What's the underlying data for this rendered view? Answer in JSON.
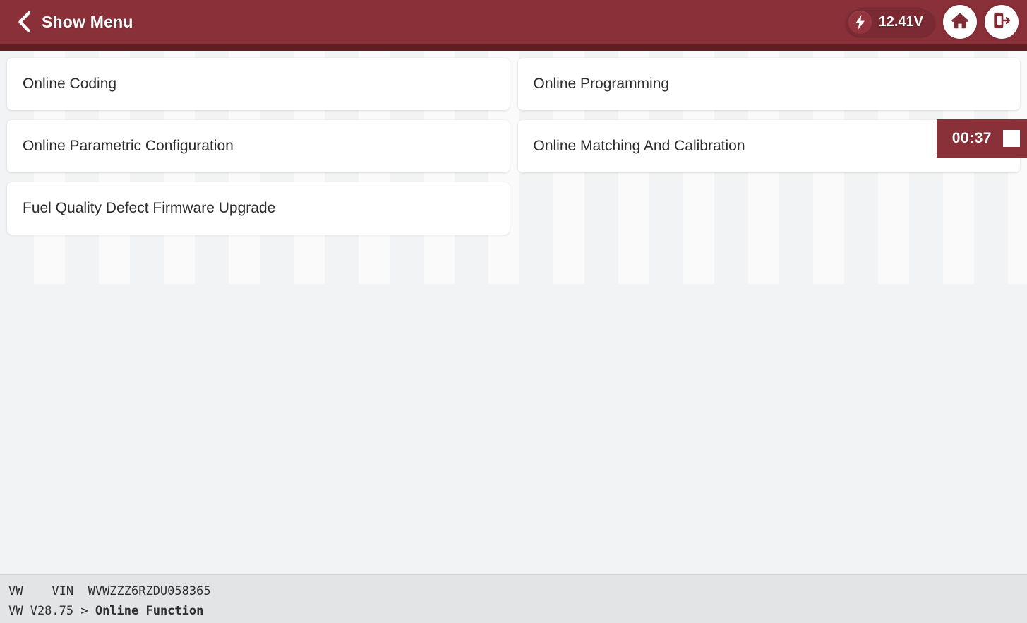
{
  "header": {
    "back_icon": "chevron-left-icon",
    "title": "Show Menu",
    "voltage": {
      "icon": "lightning-bolt-icon",
      "value": "12.41V"
    },
    "home_icon": "home-icon",
    "exit_icon": "exit-icon"
  },
  "menu": {
    "rows": [
      {
        "left": {
          "label": "Online Coding"
        },
        "right": {
          "label": "Online Programming"
        }
      },
      {
        "left": {
          "label": "Online Parametric Configuration"
        },
        "right": {
          "label": "Online Matching And Calibration",
          "timer": {
            "value": "00:37",
            "stop_icon": "stop-square-icon"
          }
        }
      },
      {
        "left": {
          "label": "Fuel Quality Defect Firmware Upgrade"
        },
        "right": {
          "label": ""
        }
      }
    ]
  },
  "footer": {
    "line1_make": "VW",
    "line1_vin_label": "VIN",
    "line1_vin_value": "WVWZZZ6RZDU058365",
    "line1": "VW    VIN  WVWZZZ6RZDU058365",
    "line2_prefix": "VW V28.75 > ",
    "line2_path": "Online Function",
    "line2": "VW V28.75 > Online Function"
  },
  "colors": {
    "header_red": "#8a3039",
    "header_underline": "#601e22",
    "pill_red": "#7b2a33",
    "background": "#f2f3f4",
    "card_white": "#ffffff",
    "footer_gray": "#e3e4e5",
    "text_dark": "#2c2c2c"
  }
}
